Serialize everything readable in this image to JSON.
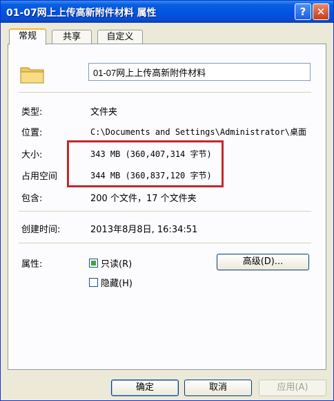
{
  "window": {
    "title": "01-07网上上传高新附件材料 属性",
    "help_label": "?",
    "close_label": "✕"
  },
  "tabs": [
    {
      "label": "常规",
      "active": true
    },
    {
      "label": "共享",
      "active": false
    },
    {
      "label": "自定义",
      "active": false
    }
  ],
  "general": {
    "icon": "folder-icon",
    "name_value": "01-07网上上传高新附件材料",
    "type_label": "类型:",
    "type_value": "文件夹",
    "location_label": "位置:",
    "location_value": "C:\\Documents and Settings\\Administrator\\桌面",
    "size_label": "大小:",
    "size_value": "343 MB (360,407,314 字节)",
    "disk_size_label": "占用空间",
    "disk_size_value": "344 MB (360,837,120 字节)",
    "contains_label": "包含:",
    "contains_value": "200 个文件，17 个文件夹",
    "created_label": "创建时间:",
    "created_value": "2013年8月8日, 16:34:51",
    "attributes_label": "属性:",
    "readonly_label": "只读(R)",
    "readonly_state": "mixed",
    "hidden_label": "隐藏(H)",
    "hidden_state": "unchecked",
    "advanced_label": "高级(D)..."
  },
  "buttons": {
    "ok_label": "确定",
    "cancel_label": "取消",
    "apply_label": "应用(A)"
  },
  "colors": {
    "titlebar": "#0054e3",
    "highlight_box": "#c8242a",
    "readonly_check": "#3fa33f"
  }
}
